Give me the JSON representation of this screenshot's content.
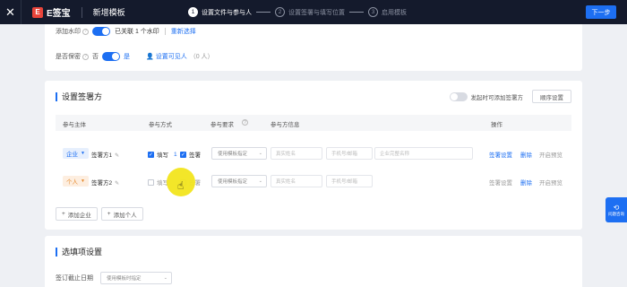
{
  "topbar": {
    "close": "✕",
    "logo_mark": "E",
    "logo_text": "E签宝",
    "title": "新增模板",
    "steps": [
      {
        "num": "1",
        "label": "设置文件与参与人"
      },
      {
        "num": "2",
        "label": "设置签署与填写位置"
      },
      {
        "num": "3",
        "label": "启用模板"
      }
    ],
    "next": "下一步"
  },
  "settings": {
    "watermark_label": "添加水印",
    "watermark_status": "已关联 1 个水印",
    "watermark_reselect": "重新选择",
    "secret_label": "是否保密",
    "secret_no": "否",
    "secret_yes": "是",
    "visible_link": "设置可见人",
    "visible_count": "（0 人）"
  },
  "signers": {
    "title": "设置签署方",
    "add_on_launch": "发起时可添加签署方",
    "order_btn": "顺序设置",
    "headers": {
      "subject": "参与主体",
      "mode": "参与方式",
      "requirement": "参与要求",
      "info": "参与方信息",
      "ops": "操作"
    },
    "rows": [
      {
        "type": "企业",
        "name": "签署方1",
        "fill": "填写",
        "fill_num": "1",
        "sign": "签署",
        "req": "使用模板指定",
        "name_ph": "真实姓名",
        "phone_ph": "手机号/邮箱",
        "company_ph": "企业完整名称",
        "op1": "签署设置",
        "op2": "删除",
        "op3": "开启预览"
      },
      {
        "type": "个人",
        "name": "签署方2",
        "fill": "填写",
        "sign": "签署",
        "req": "使用模板指定",
        "name_ph": "真实姓名",
        "phone_ph": "手机号/邮箱",
        "op1": "签署设置",
        "op2": "删除",
        "op3": "开启预览"
      }
    ],
    "add_company": "添加企业",
    "add_person": "添加个人"
  },
  "options": {
    "title": "选填项设置",
    "deadline_label": "签订截止日期",
    "deadline_value": "使用模板时指定"
  },
  "side_float": {
    "label": "问题咨询"
  },
  "colors": {
    "accent": "#1d6ff2",
    "topbar": "#141a2c",
    "cursor_highlight": "#f2e51e"
  }
}
